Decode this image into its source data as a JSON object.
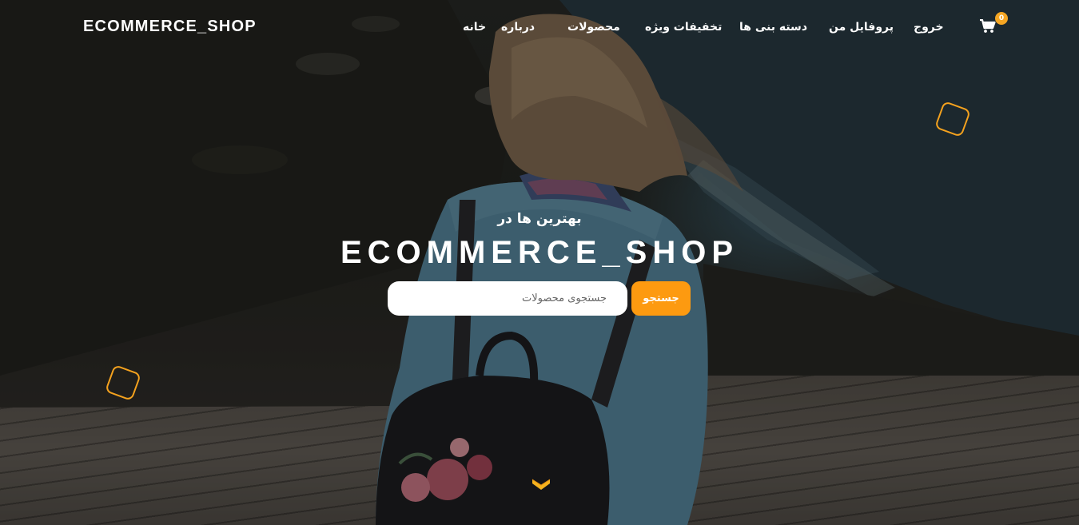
{
  "brand": "ECOMMERCE_SHOP",
  "nav": {
    "items": [
      {
        "id": "cart",
        "label": ""
      },
      {
        "id": "logout",
        "label": "خروج"
      },
      {
        "id": "profile",
        "label": "پروفایل من"
      },
      {
        "id": "categories",
        "label": "دسته بنی ها"
      },
      {
        "id": "offers",
        "label": "تخفیفات ویژه"
      },
      {
        "id": "products",
        "label": "محصولات"
      },
      {
        "id": "about",
        "label": "درباره"
      },
      {
        "id": "home",
        "label": "خانه"
      }
    ],
    "cart_count": "0",
    "cart_icon": "cart-icon"
  },
  "hero": {
    "eyebrow": "بهترین ها در",
    "headline": "ECOMMERCE_SHOP",
    "search": {
      "placeholder": "جستجوی محصولات",
      "value": "",
      "button_label": "جستجو"
    },
    "scroll_icon": "chevron-down-icon"
  },
  "colors": {
    "accent": "#fd9a10",
    "deco_border": "#f5a21e",
    "badge": "#f5a623"
  }
}
